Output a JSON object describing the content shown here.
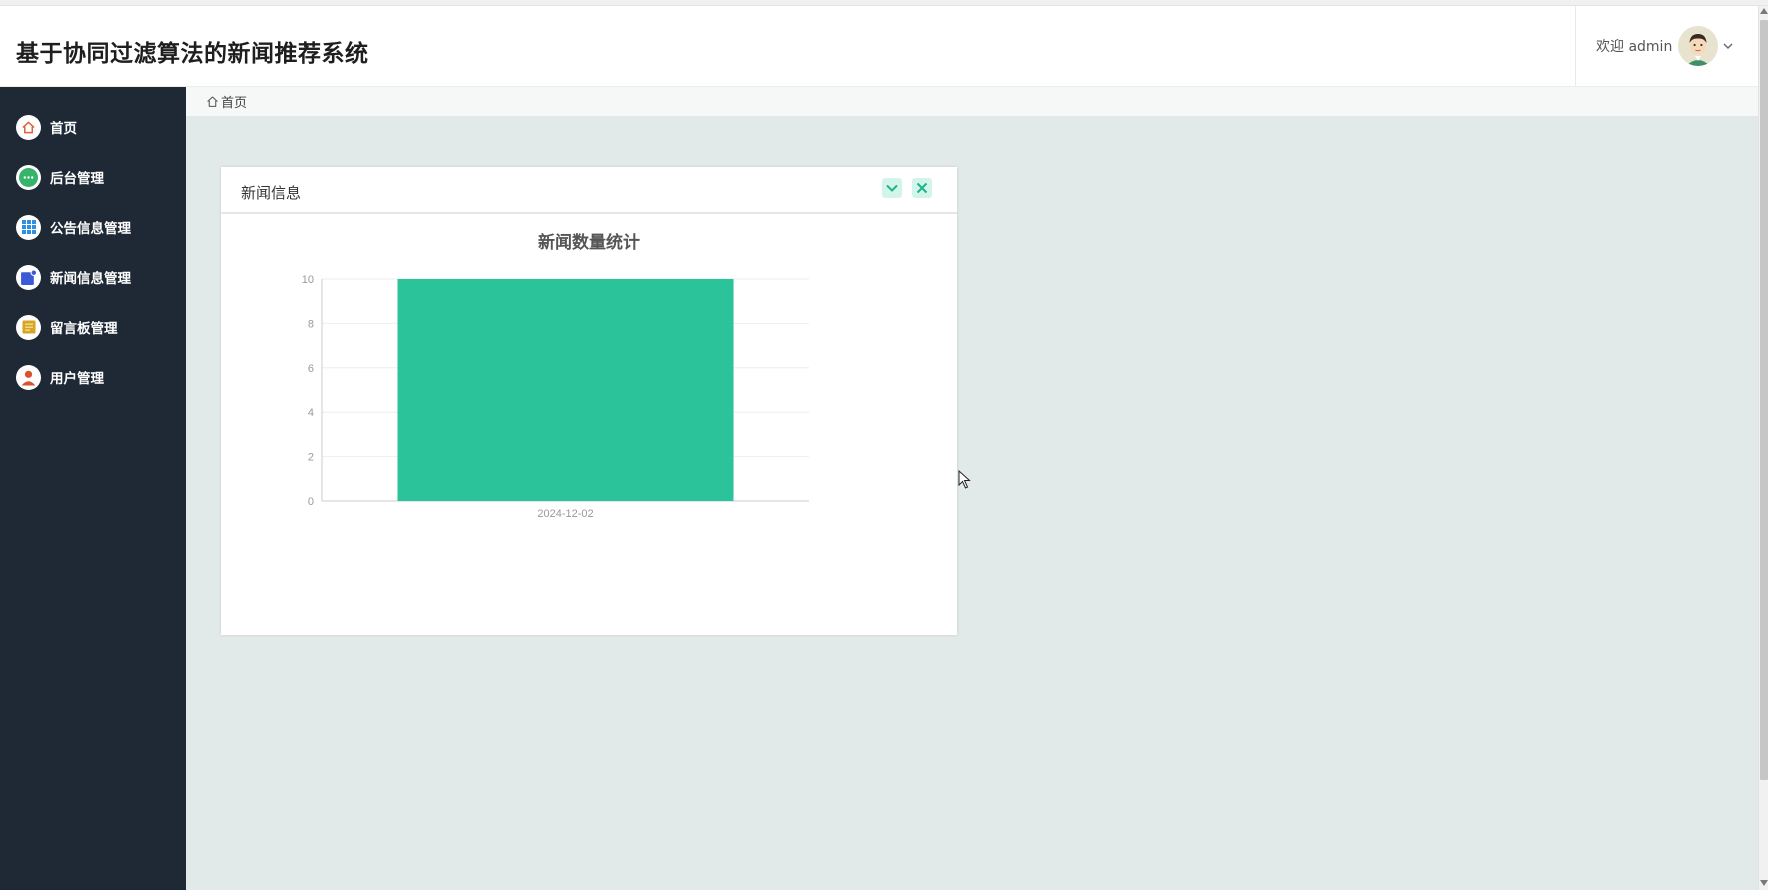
{
  "header": {
    "app_title": "基于协同过滤算法的新闻推荐系统",
    "welcome_text": "欢迎 admin"
  },
  "sidebar": {
    "items": [
      {
        "label": "首页",
        "icon": "home-icon",
        "icon_color": "#e0623b"
      },
      {
        "label": "后台管理",
        "icon": "chat-bubble-icon",
        "icon_color": "#35b46a"
      },
      {
        "label": "公告信息管理",
        "icon": "grid-icon",
        "icon_color": "#2f8fe0"
      },
      {
        "label": "新闻信息管理",
        "icon": "news-icon",
        "icon_color": "#3b5bd6"
      },
      {
        "label": "留言板管理",
        "icon": "note-icon",
        "icon_color": "#d8a423"
      },
      {
        "label": "用户管理",
        "icon": "user-icon",
        "icon_color": "#d9532e"
      }
    ]
  },
  "breadcrumb": {
    "home_label": "首页"
  },
  "panel": {
    "title": "新闻信息",
    "collapse_icon": "chevron-down-icon",
    "close_icon": "close-icon",
    "button_color": "#1fb48a"
  },
  "chart_data": {
    "type": "bar",
    "title": "新闻数量统计",
    "categories": [
      "2024-12-02"
    ],
    "values": [
      10
    ],
    "ylim": [
      0,
      10
    ],
    "yticks": [
      0,
      2,
      4,
      6,
      8,
      10
    ],
    "grid": true,
    "bar_color": "#2bc49a",
    "xlabel": "",
    "ylabel": ""
  }
}
